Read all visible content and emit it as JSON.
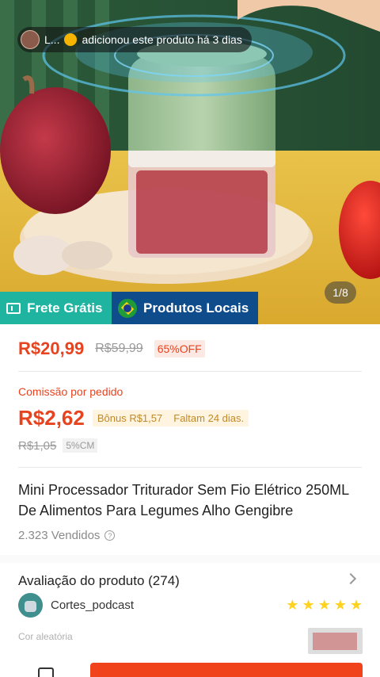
{
  "hero": {
    "notification": {
      "user": "L...",
      "text": "adicionou este produto há 3 dias"
    },
    "image_counter": "1/8",
    "tags": {
      "frete": "Frete Grátis",
      "locais": "Produtos Locais"
    }
  },
  "price": {
    "current": "R$20,99",
    "original": "R$59,99",
    "discount": "65%OFF"
  },
  "commission": {
    "label": "Comissão por pedido",
    "value": "R$2,62",
    "bonus": "Bônus R$1,57",
    "remaining": "Faltam 24 dias.",
    "old_value": "R$1,05",
    "rate": "5%CM"
  },
  "product": {
    "title": "Mini Processador Triturador Sem Fio Elétrico 250ML De Alimentos Para Legumes Alho Gengibre",
    "sold": "2.323 Vendidos",
    "help_icon_glyph": "?"
  },
  "reviews": {
    "title": "Avaliação do produto (274)",
    "reviewer": "Cortes_podcast",
    "rating": 5,
    "variant": "Cor aleatória"
  },
  "colors": {
    "accent": "#e8431f",
    "frete_tag": "#1fb4a0",
    "locais_tag": "#0f4c8c",
    "star": "#ffd21f"
  }
}
